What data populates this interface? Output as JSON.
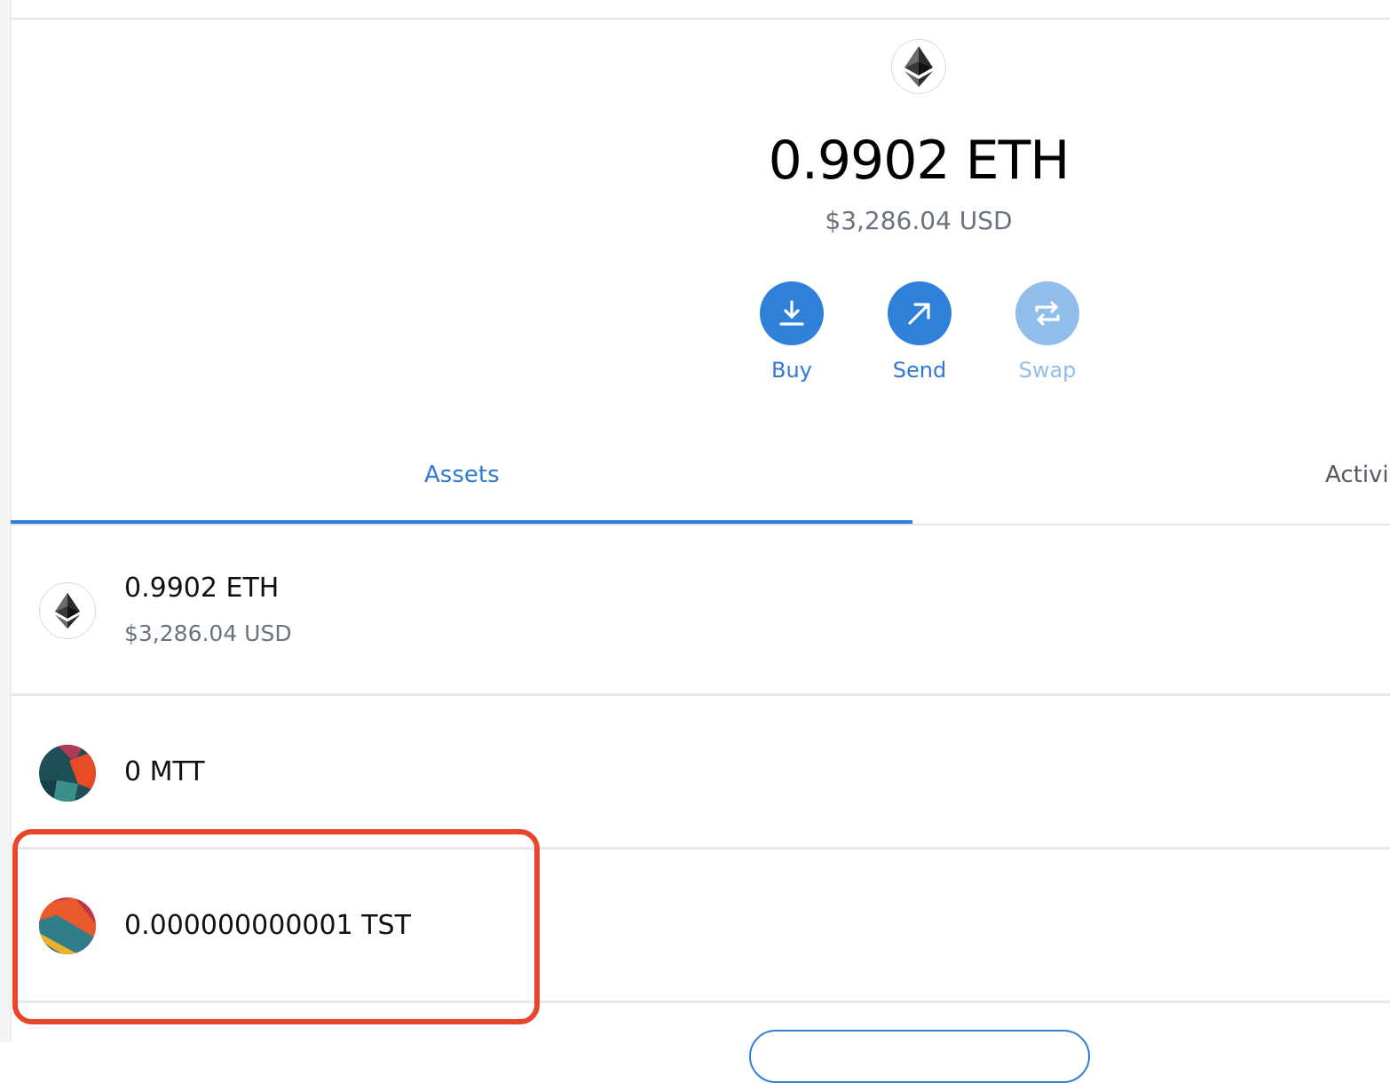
{
  "header": {
    "balance": "0.9902 ETH",
    "balance_usd": "$3,286.04 USD",
    "token_icon": "ethereum-icon"
  },
  "actions": [
    {
      "label": "Buy",
      "icon": "download-icon",
      "enabled": true
    },
    {
      "label": "Send",
      "icon": "arrow-up-right-icon",
      "enabled": true
    },
    {
      "label": "Swap",
      "icon": "swap-icon",
      "enabled": false
    }
  ],
  "tabs": [
    {
      "label": "Assets",
      "active": true
    },
    {
      "label": "Activi",
      "active": false
    }
  ],
  "assets": [
    {
      "amount": "0.9902 ETH",
      "fiat": "$3,286.04 USD",
      "icon": "ethereum-icon"
    },
    {
      "amount": "0 MTT",
      "fiat": "",
      "icon": "mtt-token-icon"
    },
    {
      "amount": "0.000000000001 TST",
      "fiat": "",
      "icon": "tst-token-icon",
      "highlighted": true
    }
  ],
  "colors": {
    "accent": "#2f80d9",
    "accent_disabled": "#90bdea",
    "highlight": "#e8462b",
    "muted_text": "#6a737d"
  }
}
